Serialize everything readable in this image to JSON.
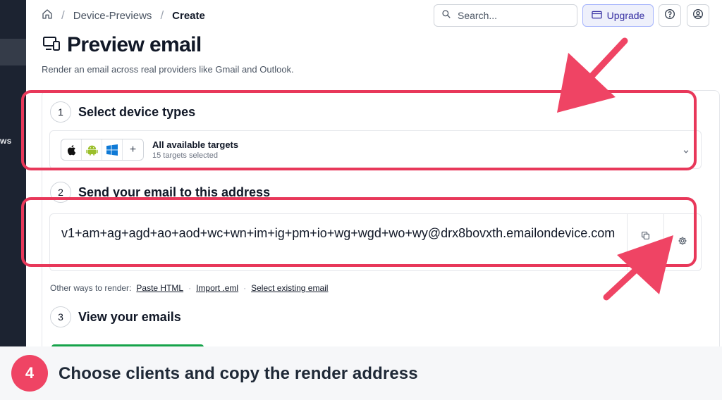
{
  "sidebar": {
    "partial_label": "ws"
  },
  "breadcrumb": {
    "items": [
      "Device-Previews",
      "Create"
    ]
  },
  "search": {
    "placeholder": "Search..."
  },
  "header": {
    "upgrade_label": "Upgrade"
  },
  "page": {
    "title": "Preview email",
    "subtitle": "Render an email across real providers like Gmail and Outlook."
  },
  "steps": [
    {
      "number": "1",
      "title": "Select device types"
    },
    {
      "number": "2",
      "title": "Send your email to this address"
    },
    {
      "number": "3",
      "title": "View your emails"
    }
  ],
  "device_select": {
    "title": "All available targets",
    "subtitle": "15 targets selected",
    "platforms": [
      "apple-icon",
      "android-icon",
      "windows-icon",
      "plus-icon"
    ],
    "plus_glyph": "+"
  },
  "address": {
    "value": "v1+am+ag+agd+ao+aod+wc+wn+im+ig+pm+io+wg+wgd+wo+wy@drx8bovxth.emailondevice.com"
  },
  "other_ways": {
    "label": "Other ways to render:",
    "links": [
      "Paste HTML",
      "Import .eml",
      "Select existing email"
    ],
    "separator": "·"
  },
  "banner": {
    "step": "4",
    "caption": "Choose clients and copy the render address"
  },
  "colors": {
    "annotation": "#e8385a",
    "upgrade_bg": "#eef0fb",
    "sidebar": "#1c2331",
    "badge": "#ef4464"
  }
}
